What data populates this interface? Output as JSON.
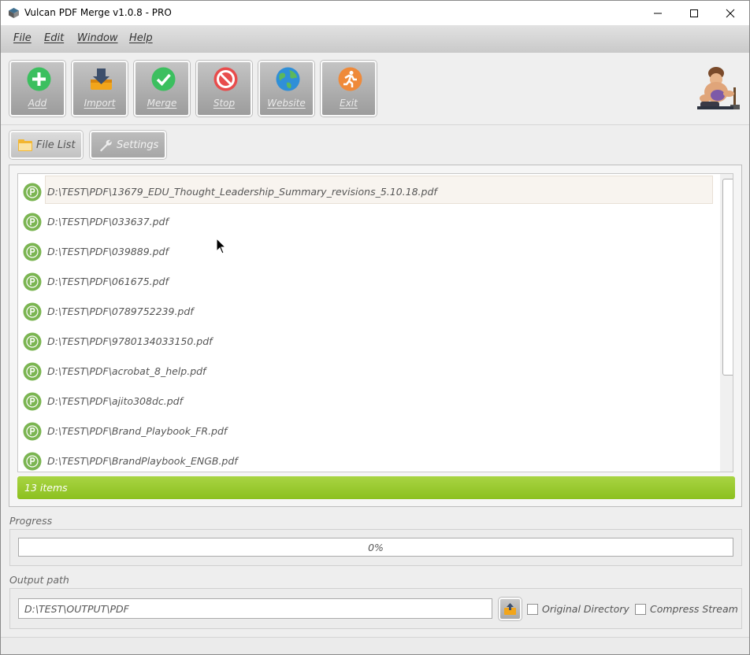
{
  "window": {
    "title": "Vulcan PDF Merge v1.0.8 - PRO"
  },
  "menu": [
    "File",
    "Edit",
    "Window",
    "Help"
  ],
  "toolbar": {
    "add": {
      "label": "Add",
      "icon": "add-icon"
    },
    "import": {
      "label": "Import",
      "icon": "import-icon"
    },
    "merge": {
      "label": "Merge",
      "icon": "merge-icon"
    },
    "stop": {
      "label": "Stop",
      "icon": "stop-icon"
    },
    "website": {
      "label": "Website",
      "icon": "globe-icon"
    },
    "exit": {
      "label": "Exit",
      "icon": "exit-icon"
    }
  },
  "tabs": {
    "file_list": "File List",
    "settings": "Settings"
  },
  "files": [
    "D:\\TEST\\PDF\\13679_EDU_Thought_Leadership_Summary_revisions_5.10.18.pdf",
    "D:\\TEST\\PDF\\033637.pdf",
    "D:\\TEST\\PDF\\039889.pdf",
    "D:\\TEST\\PDF\\061675.pdf",
    "D:\\TEST\\PDF\\0789752239.pdf",
    "D:\\TEST\\PDF\\9780134033150.pdf",
    "D:\\TEST\\PDF\\acrobat_8_help.pdf",
    "D:\\TEST\\PDF\\ajito308dc.pdf",
    "D:\\TEST\\PDF\\Brand_Playbook_FR.pdf",
    "D:\\TEST\\PDF\\BrandPlaybook_ENGB.pdf"
  ],
  "item_count": "13 items",
  "progress": {
    "label": "Progress",
    "value": 0,
    "text": "0%"
  },
  "output": {
    "label": "Output path",
    "path": "D:\\TEST\\OUTPUT\\PDF",
    "original_directory": "Original Directory",
    "compress_stream": "Compress Stream"
  },
  "colors": {
    "accent_green": "#8cc01f",
    "toolbar_button": "#b0b0b0"
  }
}
